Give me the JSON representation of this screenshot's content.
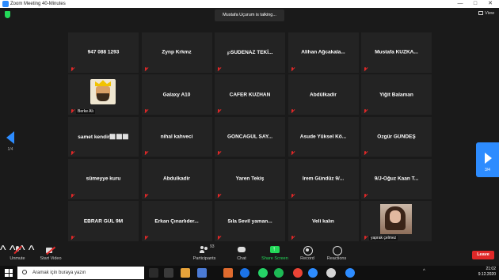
{
  "window": {
    "title": "Zoom Meeting 40-Minutes",
    "controls": [
      "—",
      "□",
      "✕"
    ]
  },
  "topbar": {
    "talking": "Mustafa Uçurum is talking...",
    "view_label": "View"
  },
  "tiles": [
    {
      "name": "947 088 1293"
    },
    {
      "name": "Zynp Krkmz"
    },
    {
      "name": "℘SUDENAZ TEKİ..."
    },
    {
      "name": "Alihan Ağcakala..."
    },
    {
      "name": "Mustafa KUZKA..."
    },
    {
      "name": "",
      "label": "Berke Alı",
      "avatar": "cartoon-king"
    },
    {
      "name": "Galaxy A10"
    },
    {
      "name": "CAFER KUZHAN"
    },
    {
      "name": "Abdülkadir"
    },
    {
      "name": "Yiğit Balaman"
    },
    {
      "name": "samet kendir⬜⬜⬜"
    },
    {
      "name": "nihal kahveci"
    },
    {
      "name": "GONCAGÜL SAY..."
    },
    {
      "name": "Asude Yüksel Kö..."
    },
    {
      "name": "Özgür GÜNDEŞ"
    },
    {
      "name": "sümeyye kuru"
    },
    {
      "name": "Abdulkadir"
    },
    {
      "name": "Yaren Tekiş"
    },
    {
      "name": "İrem Gündüz 9/..."
    },
    {
      "name": "9/J-Oğuz Kaan T..."
    },
    {
      "name": "EBRAR GÜL 9M"
    },
    {
      "name": "Erkan Çınarlıder..."
    },
    {
      "name": "Sıla Sevil yaman..."
    },
    {
      "name": "Veli kalın"
    },
    {
      "name": "",
      "label": "yaprak çelmez",
      "avatar": "photo"
    }
  ],
  "nav": {
    "left_page": "1/4",
    "right_page": "3/4"
  },
  "controls": {
    "unmute": "Unmute",
    "stop_video": "Start Video",
    "participants": "Participants",
    "participants_count": "93",
    "chat": "Chat",
    "share": "Share Screen",
    "record": "Record",
    "reactions": "Reactions",
    "leave": "Leave"
  },
  "taskbar": {
    "search_placeholder": "Aramak için buraya yazın",
    "time": "21:02",
    "date": "9.12.2020",
    "app_colors": [
      "#2b2b2b",
      "#3a3a3a",
      "#e8a33a",
      "#4b7bd6",
      "#e06b2e",
      "#1b73e8",
      "#25d366",
      "#1db954",
      "#ea4335",
      "#2d8cff",
      "#d4d4d4",
      "#2d8cff"
    ]
  },
  "colors": {
    "accent": "#2d8cff",
    "leave": "#e02828",
    "share": "#23d959",
    "muted": "#e02828"
  }
}
